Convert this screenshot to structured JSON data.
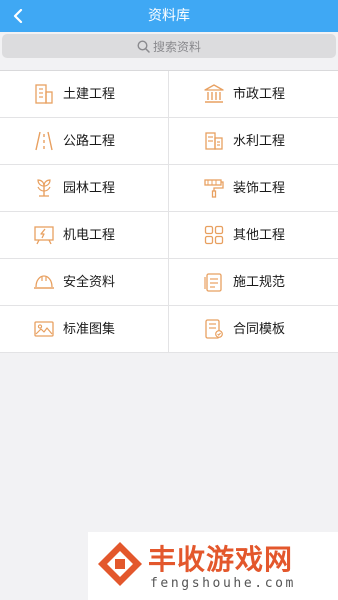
{
  "header": {
    "title": "资料库",
    "back_icon": "chevron-left-icon"
  },
  "search": {
    "placeholder": "搜索资料",
    "icon": "search-icon"
  },
  "categories": [
    {
      "label": "土建工程",
      "icon": "building-icon"
    },
    {
      "label": "市政工程",
      "icon": "government-building-icon"
    },
    {
      "label": "公路工程",
      "icon": "road-icon"
    },
    {
      "label": "水利工程",
      "icon": "water-conservancy-icon"
    },
    {
      "label": "园林工程",
      "icon": "plant-icon"
    },
    {
      "label": "装饰工程",
      "icon": "paint-roller-icon"
    },
    {
      "label": "机电工程",
      "icon": "electric-board-icon"
    },
    {
      "label": "其他工程",
      "icon": "grid-apps-icon"
    },
    {
      "label": "安全资料",
      "icon": "safety-helmet-icon"
    },
    {
      "label": "施工规范",
      "icon": "document-stack-icon"
    },
    {
      "label": "标准图集",
      "icon": "image-album-icon"
    },
    {
      "label": "合同模板",
      "icon": "contract-document-icon"
    }
  ],
  "watermark": {
    "name": "丰收游戏网",
    "url": "fengshouhe.com"
  },
  "colors": {
    "header": "#3fa8f4",
    "icon": "#e8a060",
    "watermark": "#e3572c"
  }
}
